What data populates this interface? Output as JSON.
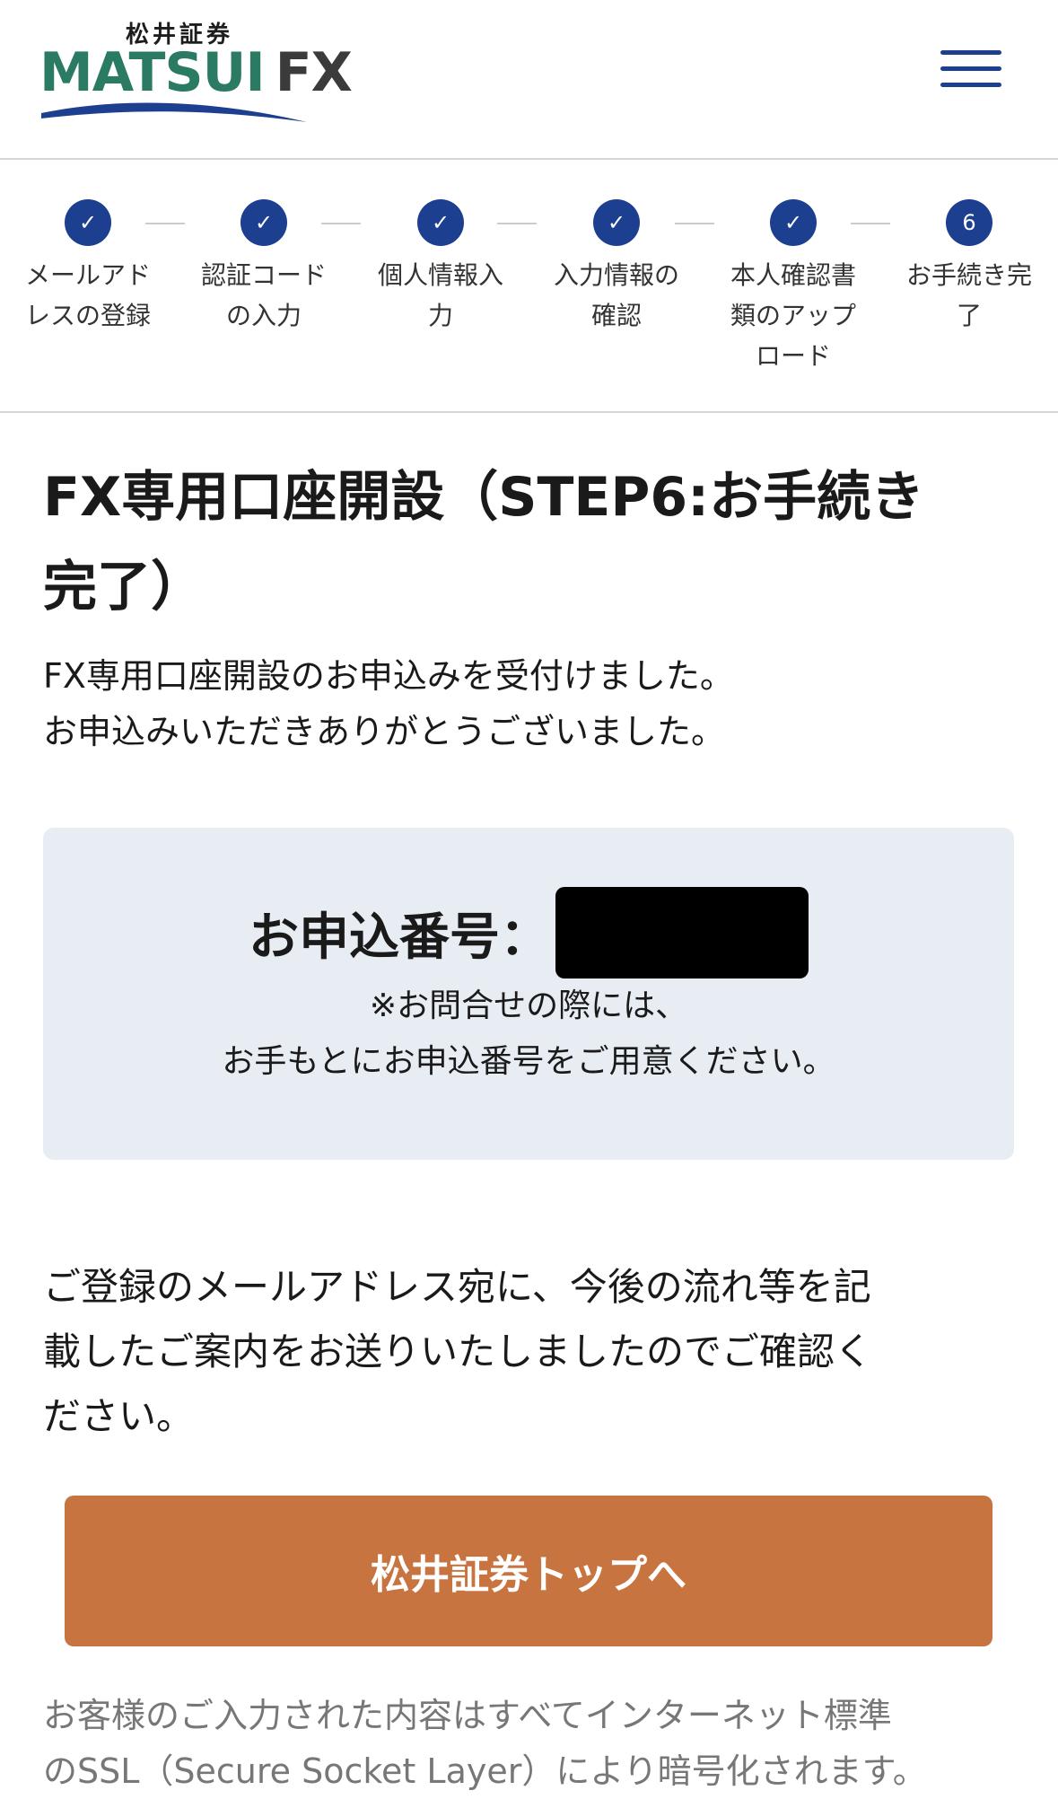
{
  "header": {
    "logo_jp": "松井証券",
    "logo_matsui": "MATSUI",
    "logo_fx": "FX",
    "logo_colors": {
      "matsui": "#2a7a64",
      "fx": "#3b3b3b",
      "swoosh": "#1d3f8f"
    },
    "menu_icon": "hamburger-menu-icon"
  },
  "stepper": {
    "accent_color": "#1d3f8f",
    "steps": [
      {
        "label_line1": "メールアド",
        "label_line2": "レスの登録",
        "label_line3": "",
        "state": "done",
        "marker": "✓"
      },
      {
        "label_line1": "認証コード",
        "label_line2": "の入力",
        "label_line3": "",
        "state": "done",
        "marker": "✓"
      },
      {
        "label_line1": "個人情報入",
        "label_line2": "力",
        "label_line3": "",
        "state": "done",
        "marker": "✓"
      },
      {
        "label_line1": "入力情報の",
        "label_line2": "確認",
        "label_line3": "",
        "state": "done",
        "marker": "✓"
      },
      {
        "label_line1": "本人確認書",
        "label_line2": "類のアップ",
        "label_line3": "ロード",
        "state": "done",
        "marker": "✓"
      },
      {
        "label_line1": "お手続き完",
        "label_line2": "了",
        "label_line3": "",
        "state": "current",
        "marker": "6"
      }
    ]
  },
  "main": {
    "title_line1": "FX専用口座開設（STEP6:お手続き",
    "title_line2": "完了）",
    "lead_line1": "FX専用口座開設のお申込みを受付けました。",
    "lead_line2": "お申込みいただきありがとうございました。"
  },
  "info_box": {
    "bg_color": "#e8edf4",
    "app_number_label": "お申込番号：",
    "app_number_value": "",
    "note_line1": "※お問合せの際には、",
    "note_line2": "お手もとにお申込番号をご用意ください。"
  },
  "notice": {
    "line1": "ご登録のメールアドレス宛に、今後の流れ等を記",
    "line2": "載したご案内をお送りいたしましたのでご確認く",
    "line3": "ださい。"
  },
  "cta": {
    "label": "松井証券トップへ",
    "color": "#c87440"
  },
  "footer": {
    "line1": "お客様のご入力された内容はすべてインターネット標準",
    "line2": "のSSL（Secure Socket Layer）により暗号化されます。"
  }
}
